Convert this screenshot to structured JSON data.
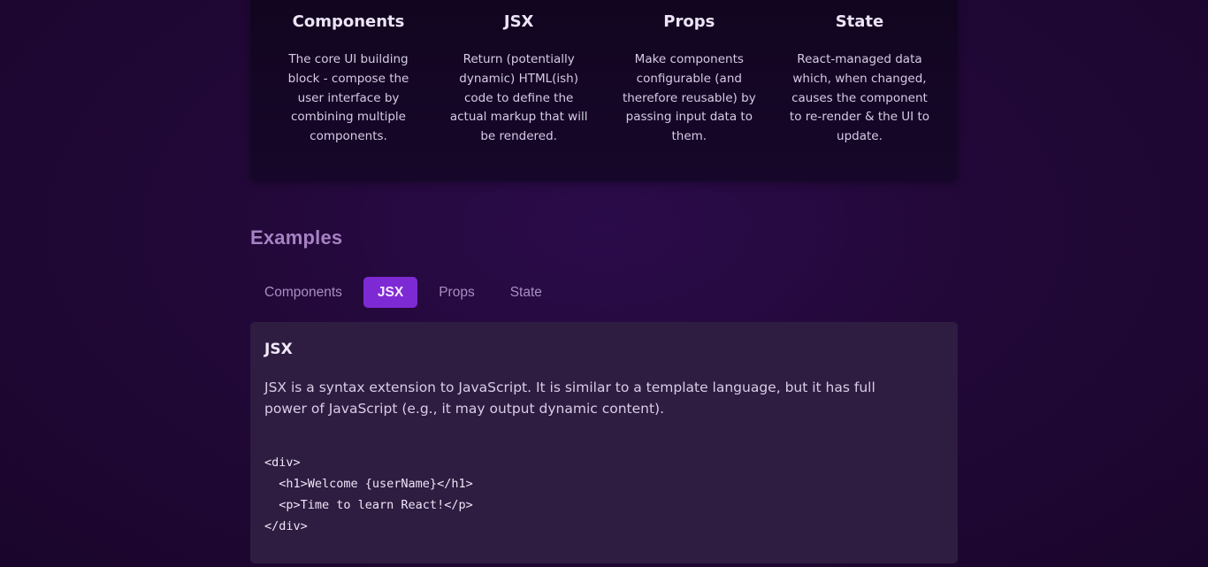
{
  "concepts": [
    {
      "title": "Components",
      "description": "The core UI building block - compose the user interface by combining multiple components."
    },
    {
      "title": "JSX",
      "description": "Return (potentially dynamic) HTML(ish) code to define the actual markup that will be rendered."
    },
    {
      "title": "Props",
      "description": "Make components configurable (and therefore reusable) by passing input data to them."
    },
    {
      "title": "State",
      "description": "React-managed data which, when changed, causes the component to re-render & the UI to update."
    }
  ],
  "examples": {
    "title": "Examples",
    "tabs": [
      "Components",
      "JSX",
      "Props",
      "State"
    ],
    "active_tab": "JSX",
    "content": {
      "title": "JSX",
      "description": "JSX is a syntax extension to JavaScript. It is similar to a template language, but it has full power of JavaScript (e.g., it may output dynamic content).",
      "code_lines": [
        "<div>",
        "  <h1>Welcome {userName}</h1>",
        "  <p>Time to learn React!</p>",
        "</div>"
      ]
    }
  },
  "colors": {
    "accent": "#7e2ad4",
    "heading_muted": "#a782c3",
    "panel": "#2e1c41",
    "background": "#220838"
  }
}
